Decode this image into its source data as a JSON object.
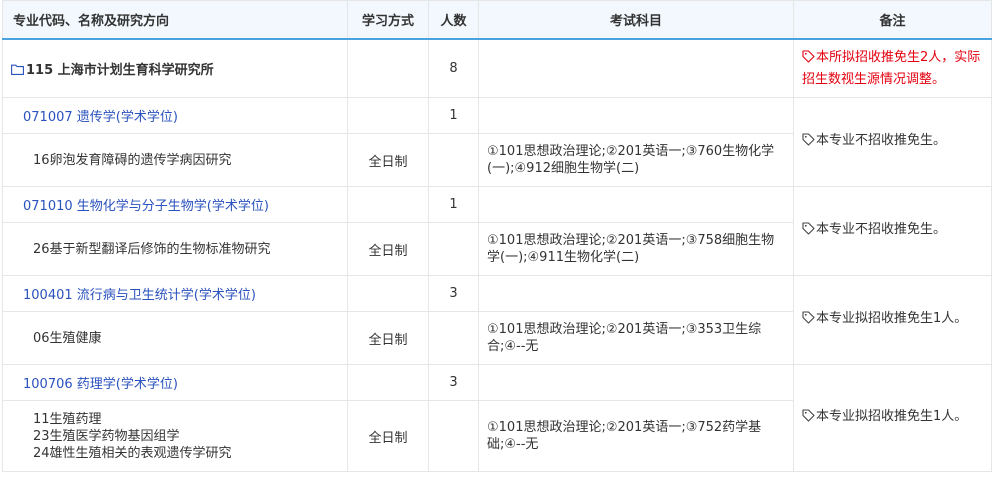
{
  "headers": {
    "code_name": "专业代码、名称及研究方向",
    "mode": "学习方式",
    "count": "人数",
    "exam": "考试科目",
    "remark": "备注"
  },
  "department": {
    "name": "115 上海市计划生育科学研究所",
    "count": "8",
    "remark": "本所拟招收推免生2人，实际招生数视生源情况调整。"
  },
  "majors": [
    {
      "name": "071007 遗传学(学术学位)",
      "count": "1",
      "direction": "16卵泡发育障碍的遗传学病因研究",
      "mode": "全日制",
      "exam": "①101思想政治理论;②201英语一;③760生物化学(一);④912细胞生物学(二)",
      "remark": "本专业不招收推免生。"
    },
    {
      "name": "071010 生物化学与分子生物学(学术学位)",
      "count": "1",
      "direction": "26基于新型翻译后修饰的生物标准物研究",
      "mode": "全日制",
      "exam": "①101思想政治理论;②201英语一;③758细胞生物学(一);④911生物化学(二)",
      "remark": "本专业不招收推免生。"
    },
    {
      "name": "100401 流行病与卫生统计学(学术学位)",
      "count": "3",
      "direction": "06生殖健康",
      "mode": "全日制",
      "exam": "①101思想政治理论;②201英语一;③353卫生综合;④--无",
      "remark": "本专业拟招收推免生1人。"
    },
    {
      "name": "100706 药理学(学术学位)",
      "count": "3",
      "directions": [
        "11生殖药理",
        "23生殖医学药物基因组学",
        "24雄性生殖相关的表观遗传学研究"
      ],
      "mode": "全日制",
      "exam": "①101思想政治理论;②201英语一;③752药学基础;④--无",
      "remark": "本专业拟招收推免生1人。"
    }
  ]
}
